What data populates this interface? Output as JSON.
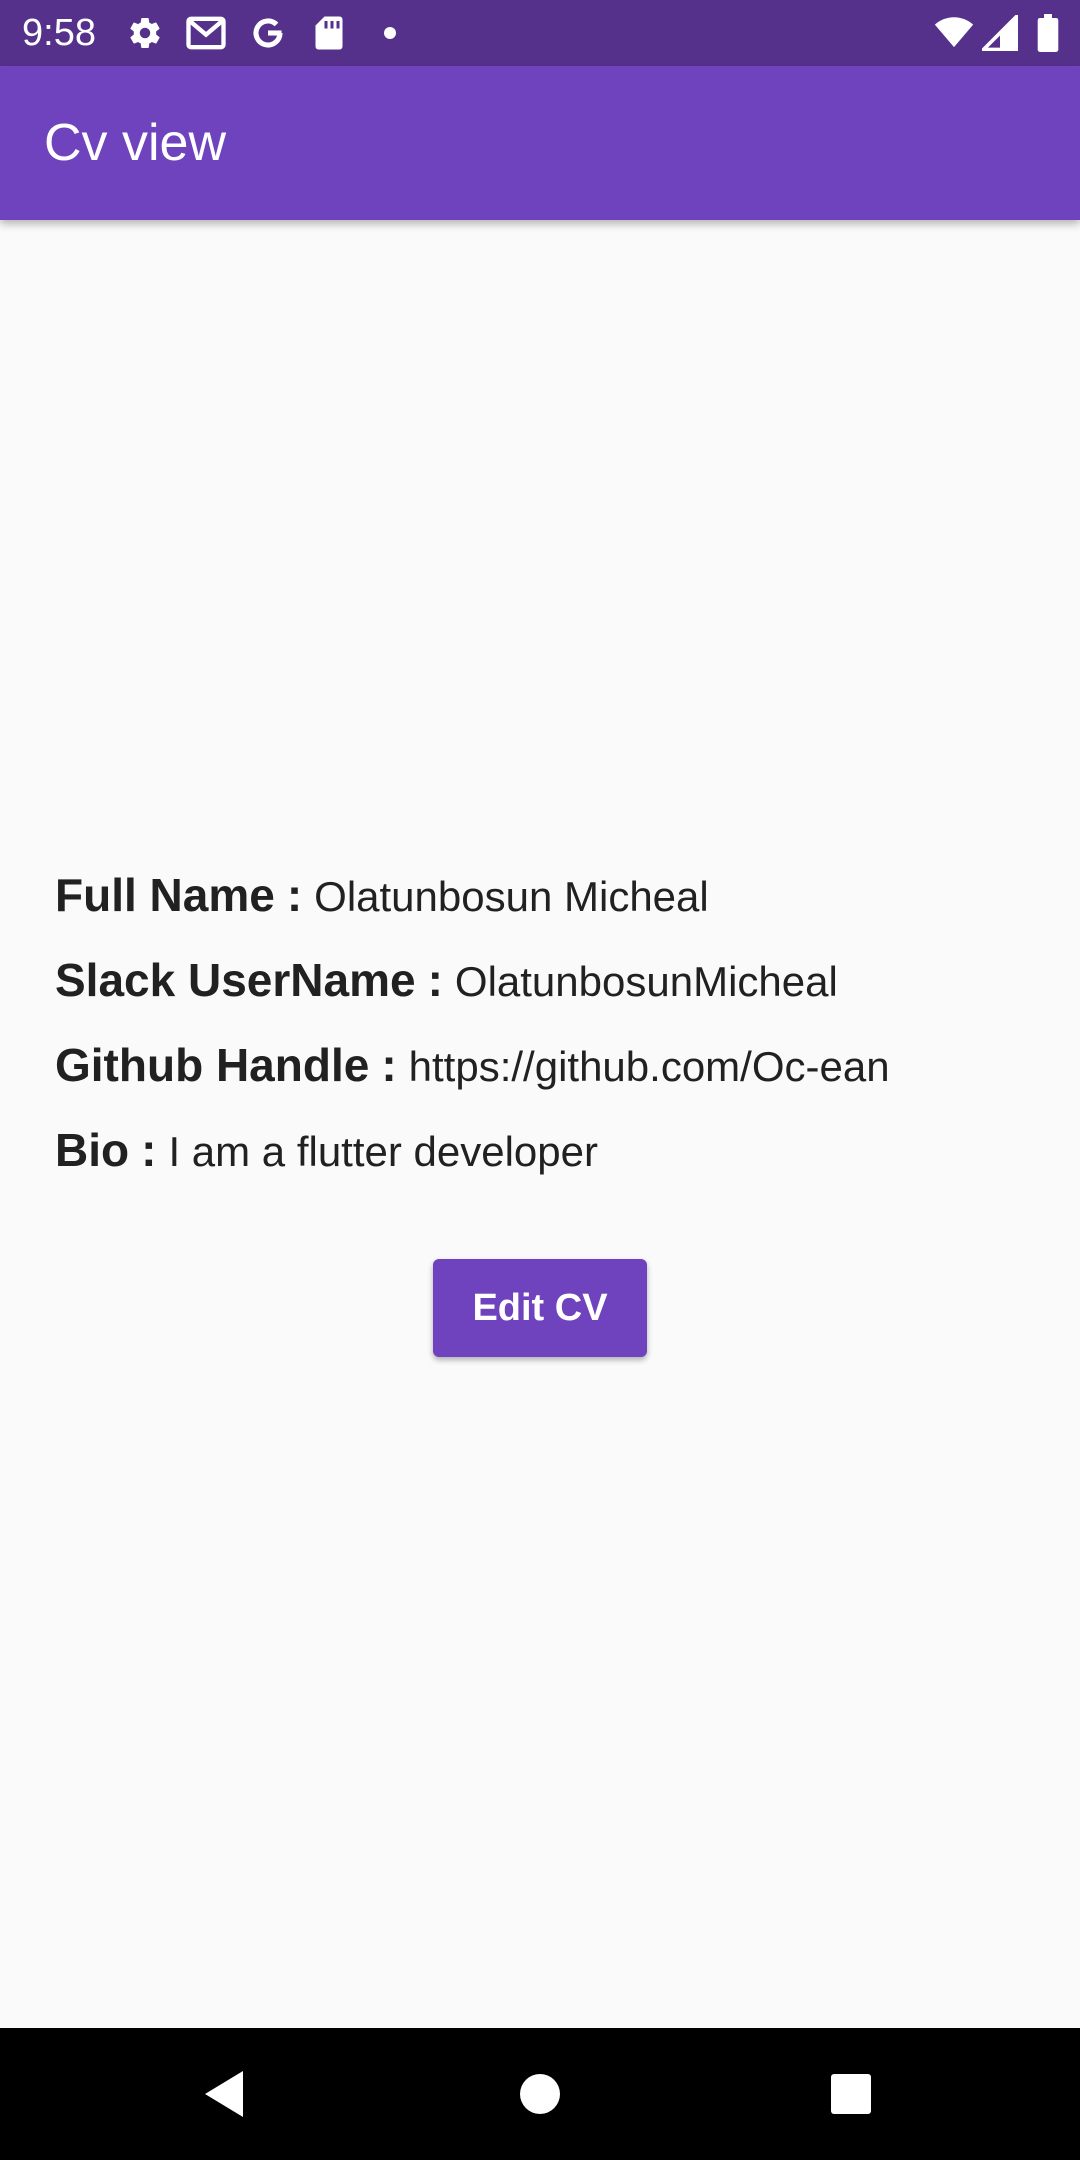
{
  "status_bar": {
    "time": "9:58",
    "icons_left": [
      "gear-icon",
      "gmail-icon",
      "google-icon",
      "sd-card-icon",
      "dot-icon"
    ],
    "icons_right": [
      "wifi-icon",
      "signal-icon",
      "battery-icon"
    ],
    "background": "#55318c"
  },
  "app_bar": {
    "title": "Cv view",
    "color": "#6f43bd"
  },
  "cv": {
    "fields": [
      {
        "label": "Full Name",
        "value": "Olatunbosun Micheal"
      },
      {
        "label": "Slack UserName",
        "value": "OlatunbosunMicheal"
      },
      {
        "label": "Github Handle",
        "value": "https://github.com/Oc-ean"
      },
      {
        "label": "Bio",
        "value": "I am a flutter developer"
      }
    ],
    "separator": ":"
  },
  "edit_button": {
    "label": "Edit CV"
  },
  "nav_bar": {
    "buttons": [
      "back-icon",
      "home-icon",
      "recents-icon"
    ]
  }
}
